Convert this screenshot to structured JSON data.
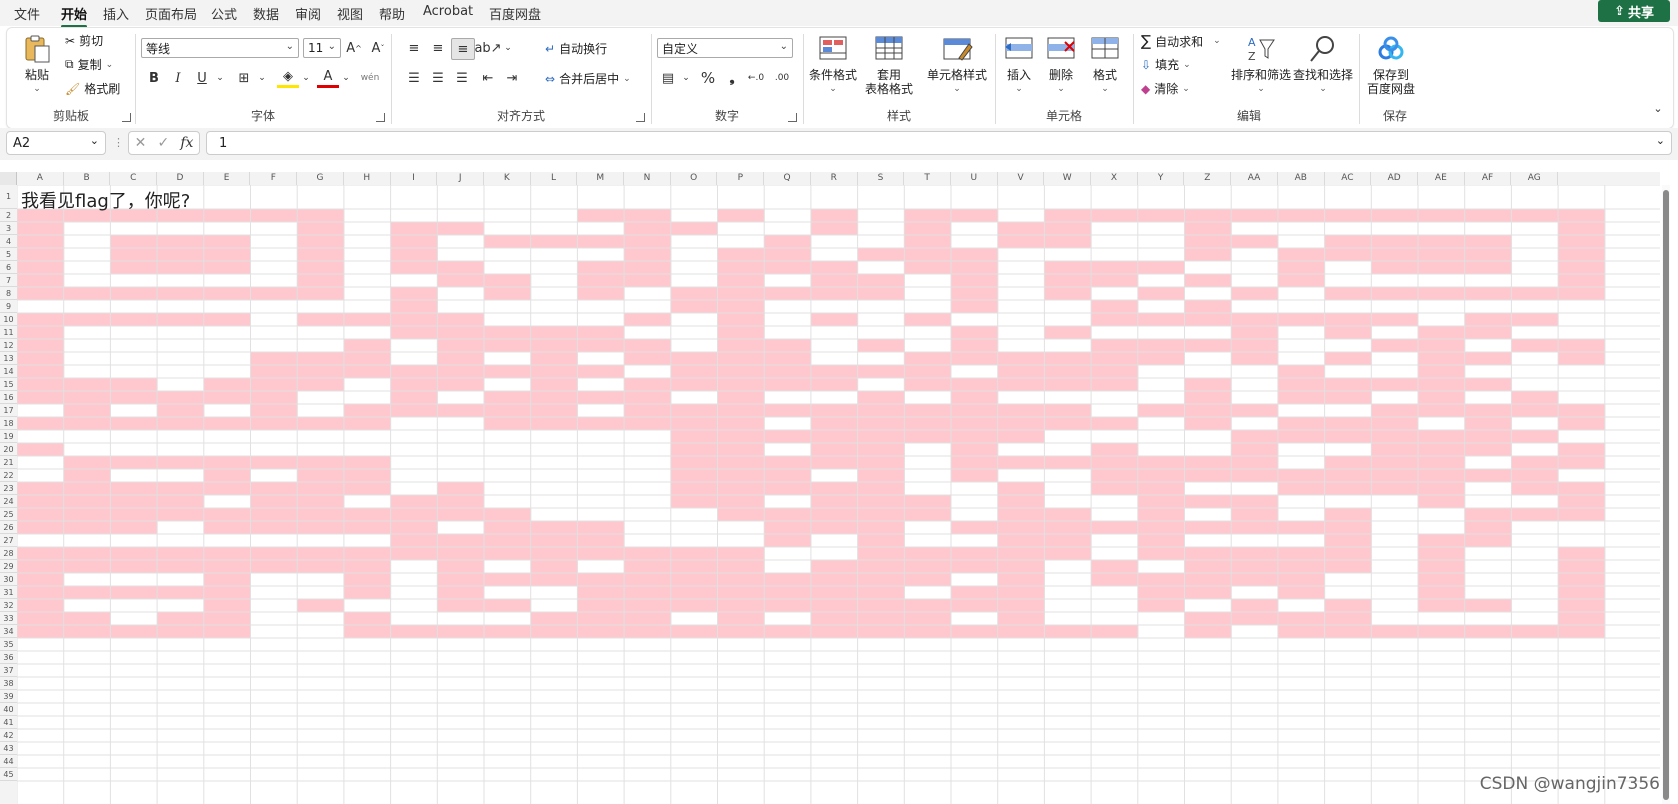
{
  "menu": {
    "items": [
      "文件",
      "开始",
      "插入",
      "页面布局",
      "公式",
      "数据",
      "审阅",
      "视图",
      "帮助",
      "Acrobat",
      "百度网盘"
    ],
    "active": "开始",
    "share_label": "共享"
  },
  "ribbon": {
    "clipboard": {
      "title": "剪贴板",
      "paste": "粘贴",
      "cut": "剪切",
      "copy": "复制",
      "format_painter": "格式刷"
    },
    "font": {
      "title": "字体",
      "font_name": "等线",
      "font_size": "11",
      "bold": "B",
      "italic": "I",
      "underline": "U",
      "phonetic": "wén"
    },
    "alignment": {
      "title": "对齐方式",
      "wrap_text": "自动换行",
      "merge_center": "合并后居中"
    },
    "number": {
      "title": "数字",
      "format": "自定义",
      "percent": "%",
      "comma": "❟"
    },
    "styles": {
      "title": "样式",
      "conditional": "条件格式",
      "table_format_line1": "套用",
      "table_format_line2": "表格格式",
      "cell_styles": "单元格样式"
    },
    "cells": {
      "title": "单元格",
      "insert": "插入",
      "delete": "删除",
      "format": "格式"
    },
    "editing": {
      "title": "编辑",
      "autosum": "自动求和",
      "fill": "填充",
      "clear": "清除",
      "sort_filter": "排序和筛选",
      "find_select": "查找和选择"
    },
    "save": {
      "title": "保存",
      "label_line1": "保存到",
      "label_line2": "百度网盘"
    }
  },
  "formula_bar": {
    "name_box": "A2",
    "fx": "fx",
    "value": "1"
  },
  "sheet": {
    "cell_a1": "我看见flag了，你呢?",
    "columns": [
      "A",
      "B",
      "C",
      "D",
      "E",
      "F",
      "G",
      "H",
      "I",
      "J",
      "K",
      "L",
      "M",
      "N",
      "O",
      "P",
      "Q",
      "R",
      "S",
      "T",
      "U",
      "V",
      "W",
      "X",
      "Y",
      "Z",
      "AA",
      "AB",
      "AC",
      "AD",
      "AE",
      "AF",
      "AG"
    ],
    "rows": [
      "1",
      "2",
      "3",
      "4",
      "5",
      "6",
      "7",
      "8",
      "9",
      "10",
      "11",
      "12",
      "13",
      "14",
      "15",
      "16",
      "17",
      "18",
      "19",
      "20",
      "21",
      "22",
      "23",
      "24",
      "25",
      "26",
      "27",
      "28",
      "29",
      "30",
      "31",
      "32",
      "33",
      "34",
      "35",
      "36",
      "37",
      "38",
      "39",
      "40",
      "41",
      "42",
      "43",
      "44",
      "45"
    ],
    "fill_color": "#ffc7ce",
    "pattern": [
      "",
      "1111111000001101010110111111111111",
      "1000001011000110010101100100000001",
      "1011101010111100100101100110111101",
      "1011101010000101101110000101111101",
      "1011101011001101110110111001011101",
      "1000001001101101011010110101000001",
      "1111111010101011111010101010111111",
      "0000000010000011000010010100000000",
      "1111101111000101010100011111110110",
      "1000000011111001000010100010101100",
      "1000000101111101101010011110011011",
      "1000011101010111100111111010101101",
      "1000011111111011111101110001001000",
      "1110111011010111110111110101111100",
      "1111110010111101001010000101101010",
      "0101010111110111111111101110011111",
      "1111111100111111011111110101110101",
      "0000000000000011111111000011111110",
      "1000000000000011011010010010011101",
      "0111111100000011111011111110111011",
      "0100101100000011101010011111111110",
      "1111111101000011111001011001111011",
      "1111011011000011011101001110001001",
      "1111111111100001111101101010100111",
      "1110111110111000111011111111100100",
      "0000000011111000101001101000101100",
      "1111111111111111001111101111101001",
      "1111111101010111011111010111101001",
      "1000100101111111111101011111001001",
      "1111100101001111111011001101001001",
      "1000101001101111111111001010101101",
      "1101100100011101011101000111100001",
      "1111100111111111111111110101111111"
    ]
  },
  "watermark": "CSDN @wangjin7356"
}
